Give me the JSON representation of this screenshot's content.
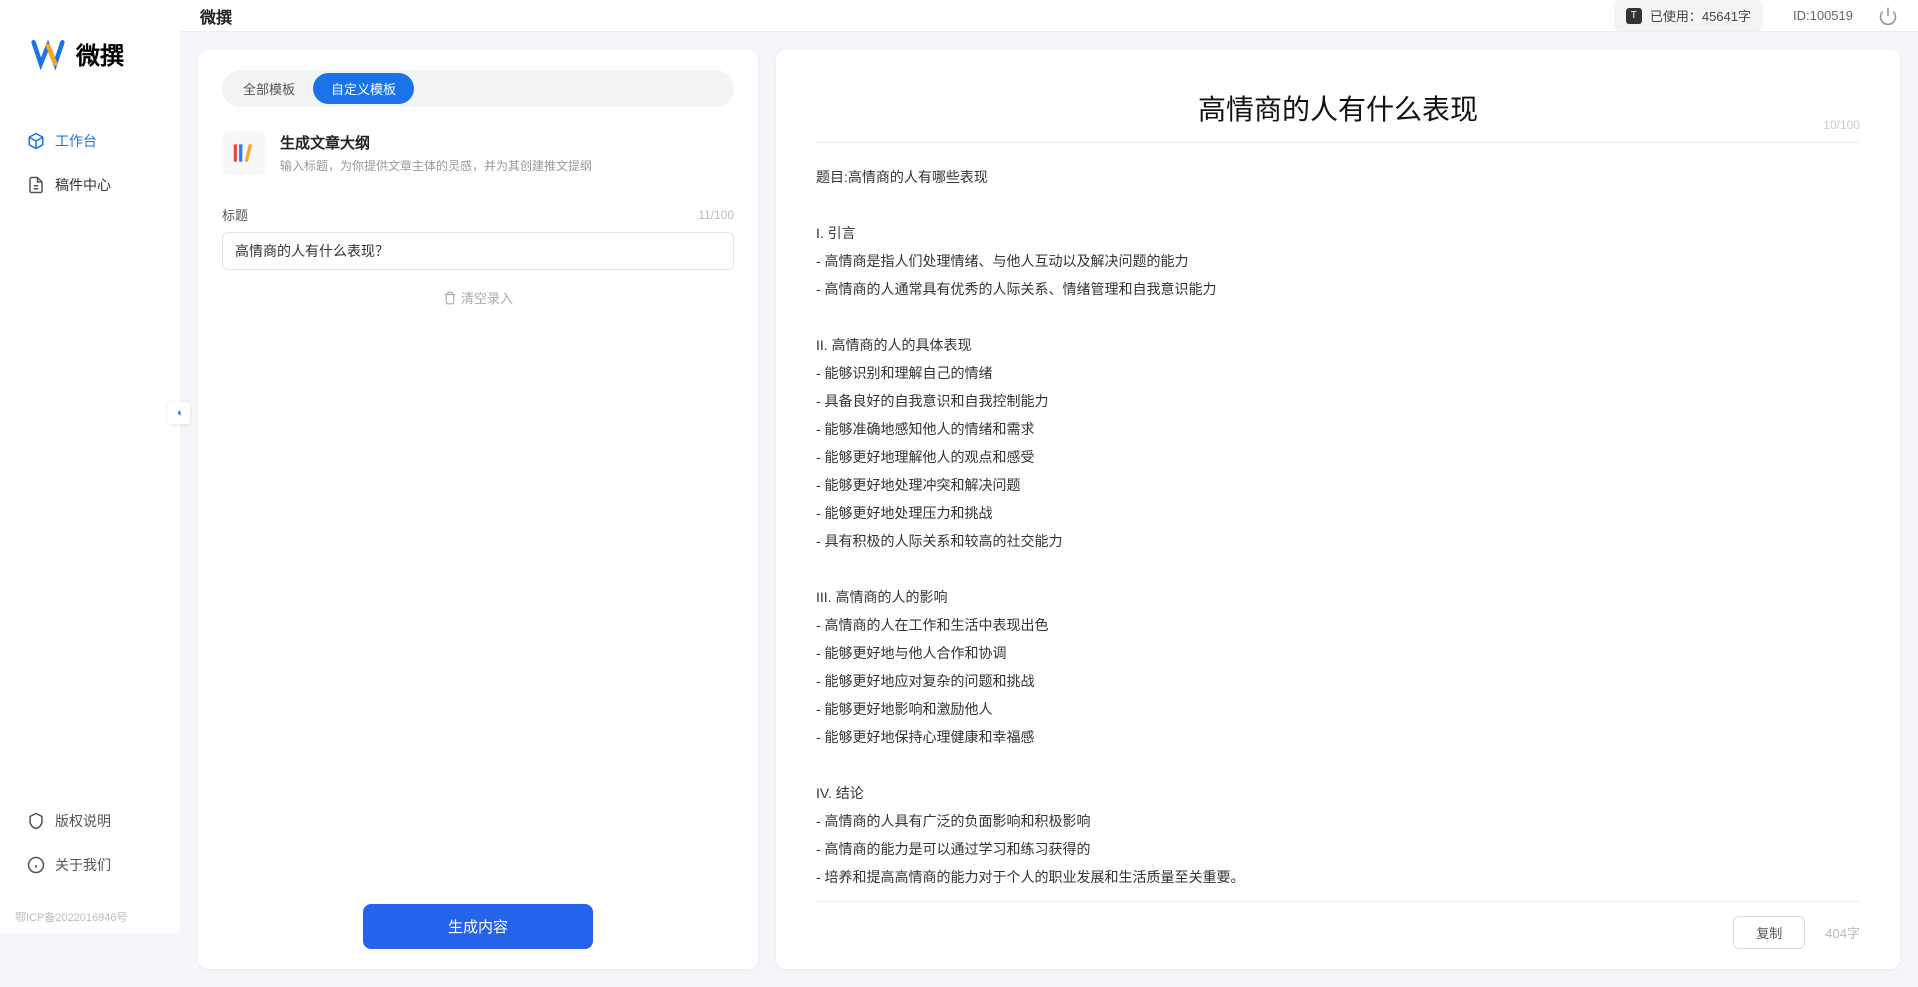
{
  "app": {
    "name": "微撰"
  },
  "sidebar": {
    "nav": [
      {
        "label": "工作台",
        "icon": "cube"
      },
      {
        "label": "稿件中心",
        "icon": "doc"
      }
    ],
    "bottom": [
      {
        "label": "版权说明",
        "icon": "shield"
      },
      {
        "label": "关于我们",
        "icon": "info"
      }
    ],
    "icp": "鄂ICP备2022016946号"
  },
  "topbar": {
    "title": "微撰",
    "usage_prefix": "已使用：",
    "usage_value": "45641字",
    "user_id": "ID:100519"
  },
  "left": {
    "tabs": [
      "全部模板",
      "自定义模板"
    ],
    "active_tab": 1,
    "template": {
      "title": "生成文章大纲",
      "desc": "输入标题，为你提供文章主体的灵感，并为其创建推文提纲"
    },
    "field": {
      "label": "标题",
      "count": "11/100",
      "value": "高情商的人有什么表现？"
    },
    "clear": "清空录入",
    "generate": "生成内容"
  },
  "right": {
    "title": "高情商的人有什么表现",
    "top_count": "10/100",
    "body": "题目:高情商的人有哪些表现\n\nI. 引言\n- 高情商是指人们处理情绪、与他人互动以及解决问题的能力\n- 高情商的人通常具有优秀的人际关系、情绪管理和自我意识能力\n\nII. 高情商的人的具体表现\n- 能够识别和理解自己的情绪\n- 具备良好的自我意识和自我控制能力\n- 能够准确地感知他人的情绪和需求\n- 能够更好地理解他人的观点和感受\n- 能够更好地处理冲突和解决问题\n- 能够更好地处理压力和挑战\n- 具有积极的人际关系和较高的社交能力\n\nIII. 高情商的人的影响\n- 高情商的人在工作和生活中表现出色\n- 能够更好地与他人合作和协调\n- 能够更好地应对复杂的问题和挑战\n- 能够更好地影响和激励他人\n- 能够更好地保持心理健康和幸福感\n\nIV. 结论\n- 高情商的人具有广泛的负面影响和积极影响\n- 高情商的能力是可以通过学习和练习获得的\n- 培养和提高高情商的能力对于个人的职业发展和生活质量至关重要。",
    "copy": "复制",
    "char_count": "404字"
  }
}
